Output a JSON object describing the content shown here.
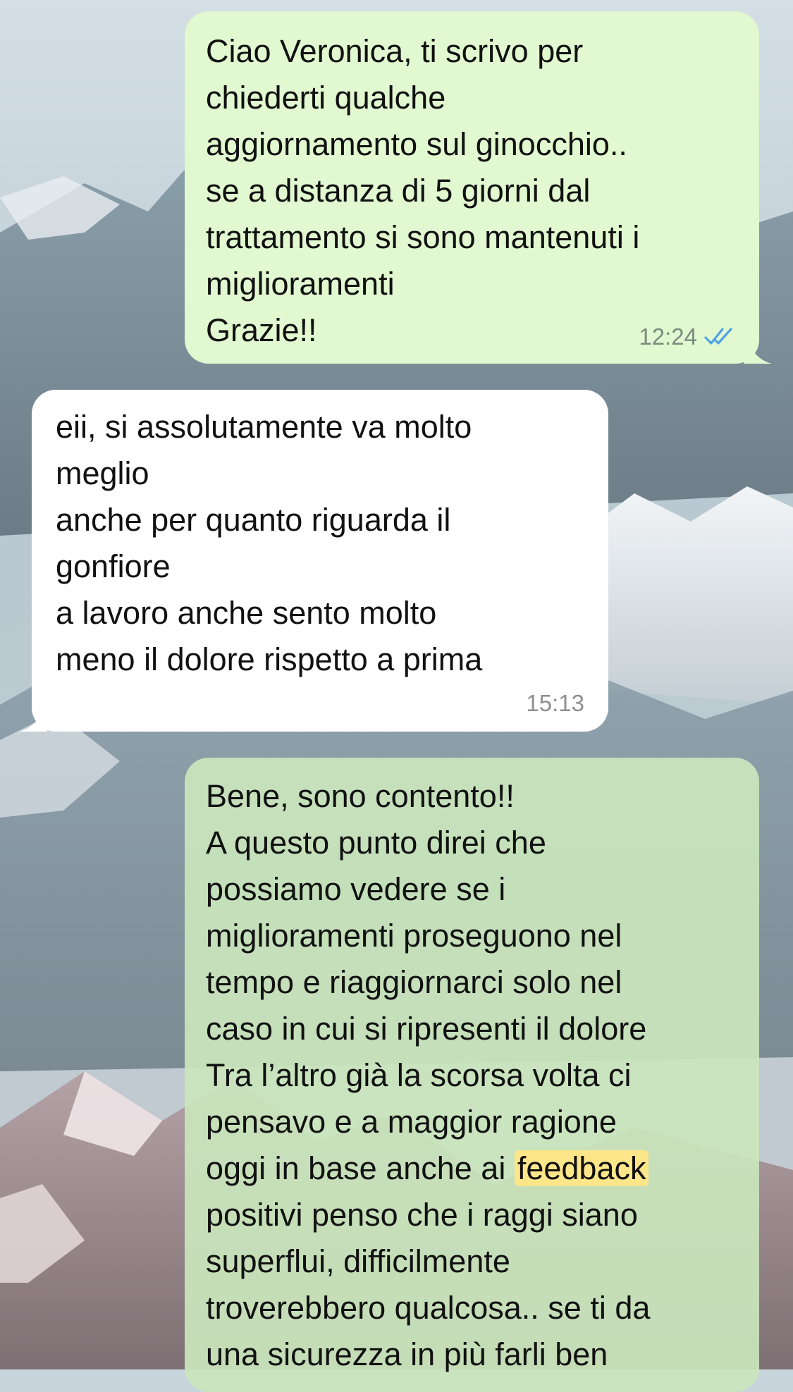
{
  "chat": {
    "messages": [
      {
        "direction": "outgoing",
        "lines": [
          "Ciao Veronica, ti scrivo per",
          "chiederti qualche",
          "aggiornamento sul ginocchio..",
          "se a distanza di 5 giorni dal",
          "trattamento si sono mantenuti i",
          "miglioramenti",
          "Grazie!!"
        ],
        "time": "12:24",
        "status_icon": "double-check-read-icon",
        "status_color": "#4ea3e6"
      },
      {
        "direction": "incoming",
        "lines": [
          "eii, si assolutamente va molto",
          "meglio",
          "anche per quanto riguarda il",
          "gonfiore",
          "a lavoro anche sento molto",
          "meno il dolore rispetto a prima"
        ],
        "time": "15:13"
      },
      {
        "direction": "outgoing",
        "lines": [
          "Bene, sono contento!!",
          "A questo punto direi che",
          "possiamo vedere se i",
          "miglioramenti proseguono nel",
          "tempo e riaggiornarci solo nel",
          "caso in cui si ripresenti il dolore",
          "Tra l’altro già la scorsa volta ci",
          "pensavo e a maggior ragione",
          "oggi in base anche ai ",
          "positivi penso che i raggi siano",
          "superflui, difficilmente",
          "troverebbero qualcosa.. se ti da",
          "una sicurezza in più farli ben"
        ],
        "highlight_word": "feedback",
        "highlight_color": "#fde68a"
      }
    ]
  },
  "colors": {
    "outgoing_bubble": "#e1f8d0",
    "incoming_bubble": "#ffffff"
  }
}
